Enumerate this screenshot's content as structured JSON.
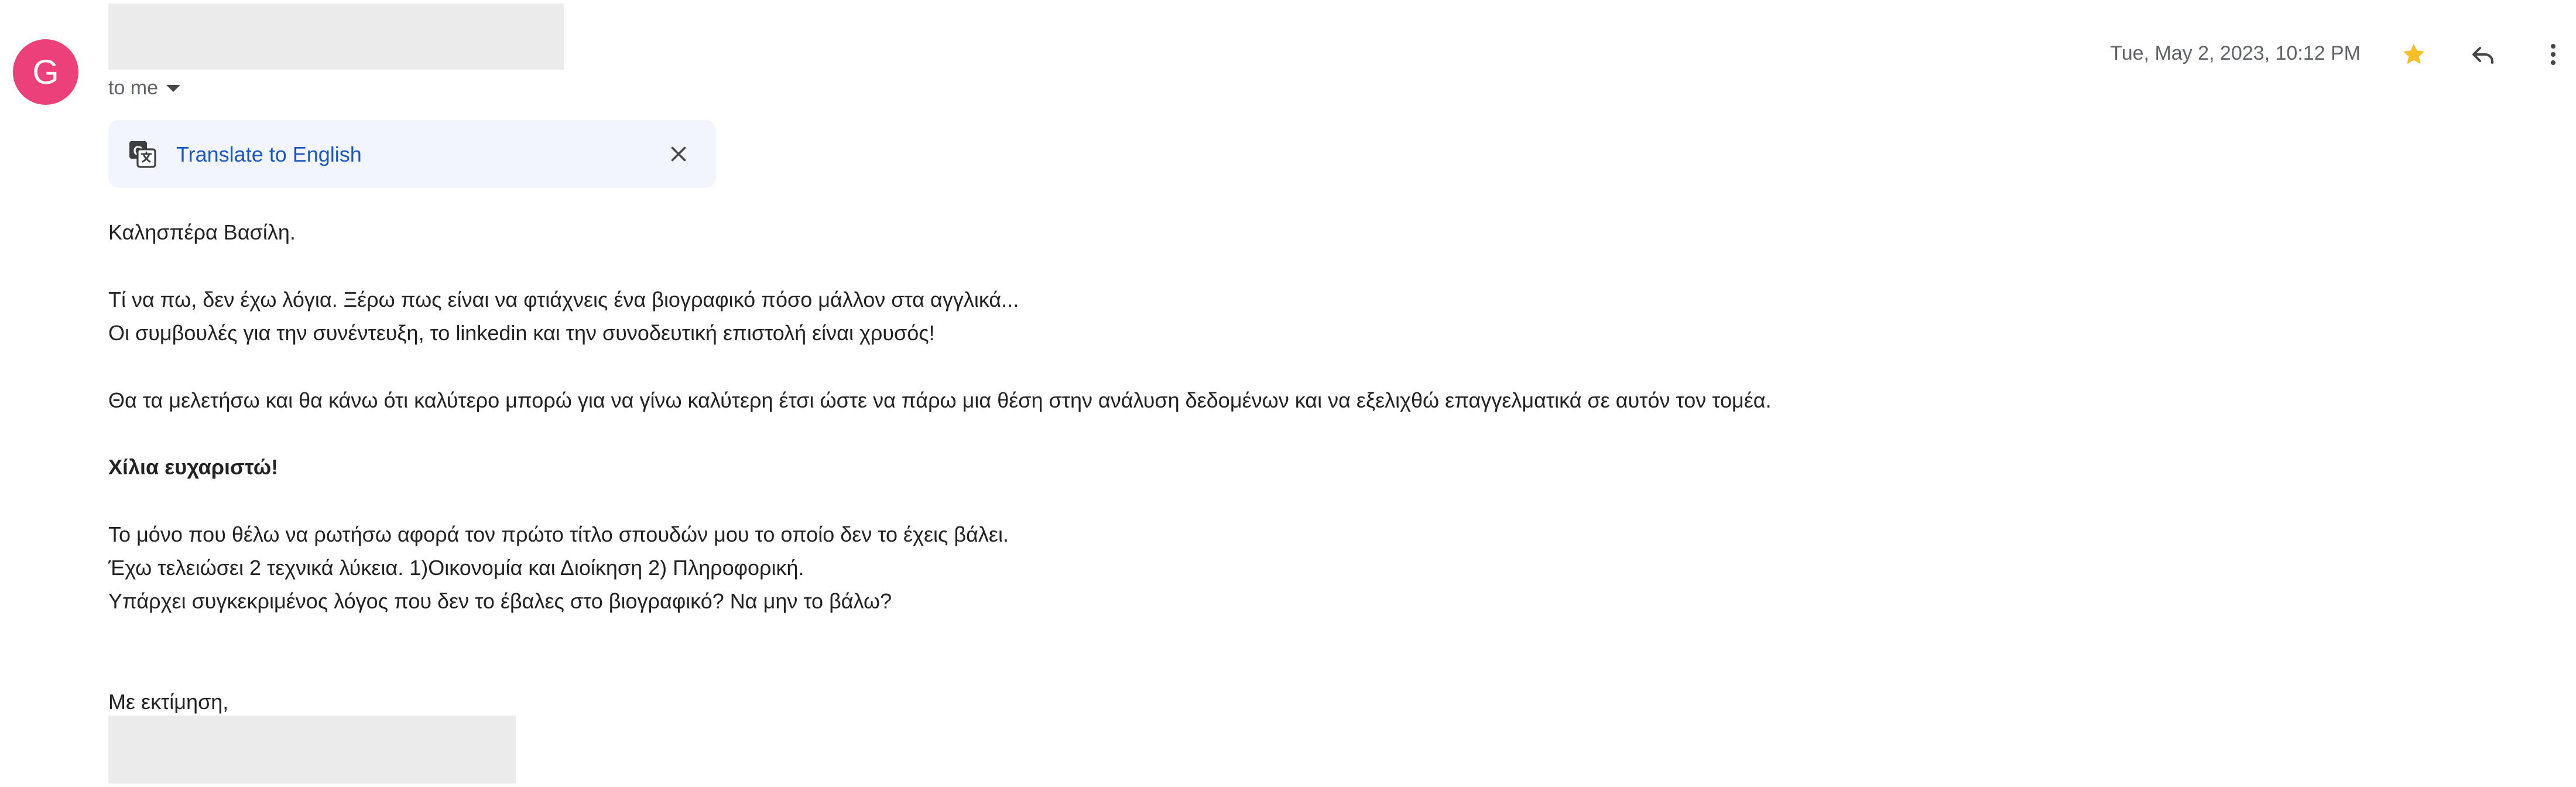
{
  "sender": {
    "avatar_letter": "G",
    "avatar_color": "#ec407a",
    "recipient_label": "to me"
  },
  "header": {
    "timestamp": "Tue, May 2, 2023, 10:12 PM",
    "icons": [
      "star-icon",
      "reply-icon",
      "more-vert-icon"
    ],
    "star_color": "#f6bf26"
  },
  "translate": {
    "link_label": "Translate to English",
    "icon": "translate-icon",
    "close_icon": "close-icon",
    "link_color": "#1a57c5"
  },
  "body": {
    "greeting": "Καλησπέρα Βασίλη.",
    "p1_line1": "Τί να πω, δεν έχω λόγια. Ξέρω πως είναι να φτιάχνεις ένα βιογραφικό πόσο μάλλον στα αγγλικά...",
    "p1_line2": "Οι συμβουλές για την συνέντευξη, το linkedin και την συνοδευτική επιστολή είναι χρυσός!",
    "p2_line1": "Θα τα μελετήσω και θα κάνω ότι καλύτερο μπορώ για να γίνω καλύτερη έτσι ώστε να πάρω μια θέση στην ανάλυση δεδομένων και να εξελιχθώ επαγγελματικά σε αυτόν τον τομέα.",
    "thanks": "Χίλια ευχαριστώ!",
    "p3_line1": "Το μόνο που θέλω να ρωτήσω αφορά τον πρώτο τίτλο σπουδών μου το οποίο δεν το έχεις βάλει.",
    "p3_line2": "Έχω τελειώσει 2 τεχνικά λύκεια. 1)Οικονομία και Διοίκηση 2) Πληροφορική.",
    "p3_line3": "Υπάρχει συγκεκριμένος λόγος που δεν το έβαλες στο βιογραφικό? Να μην το βάλω?",
    "closing": "Με εκτίμηση,"
  }
}
